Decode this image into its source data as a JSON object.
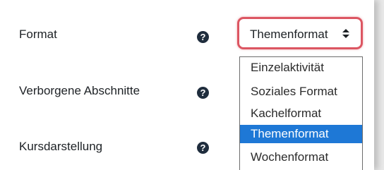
{
  "form": {
    "rows": [
      {
        "label": "Format",
        "help_glyph": "?",
        "help_icon": "question-circle-icon"
      },
      {
        "label": "Verborgene Abschnitte",
        "help_glyph": "?",
        "help_icon": "question-circle-icon"
      },
      {
        "label": "Kursdarstellung",
        "help_glyph": "?",
        "help_icon": "question-circle-icon"
      }
    ],
    "format_select": {
      "value": "Themenformat",
      "focus_border_color": "#dc5662",
      "options": [
        "Einzelaktivität",
        "Soziales Format",
        "Kachelformat",
        "Themenformat",
        "Wochenformat"
      ],
      "highlighted_option": "Themenformat",
      "highlight_color": "#1e78d6"
    }
  }
}
